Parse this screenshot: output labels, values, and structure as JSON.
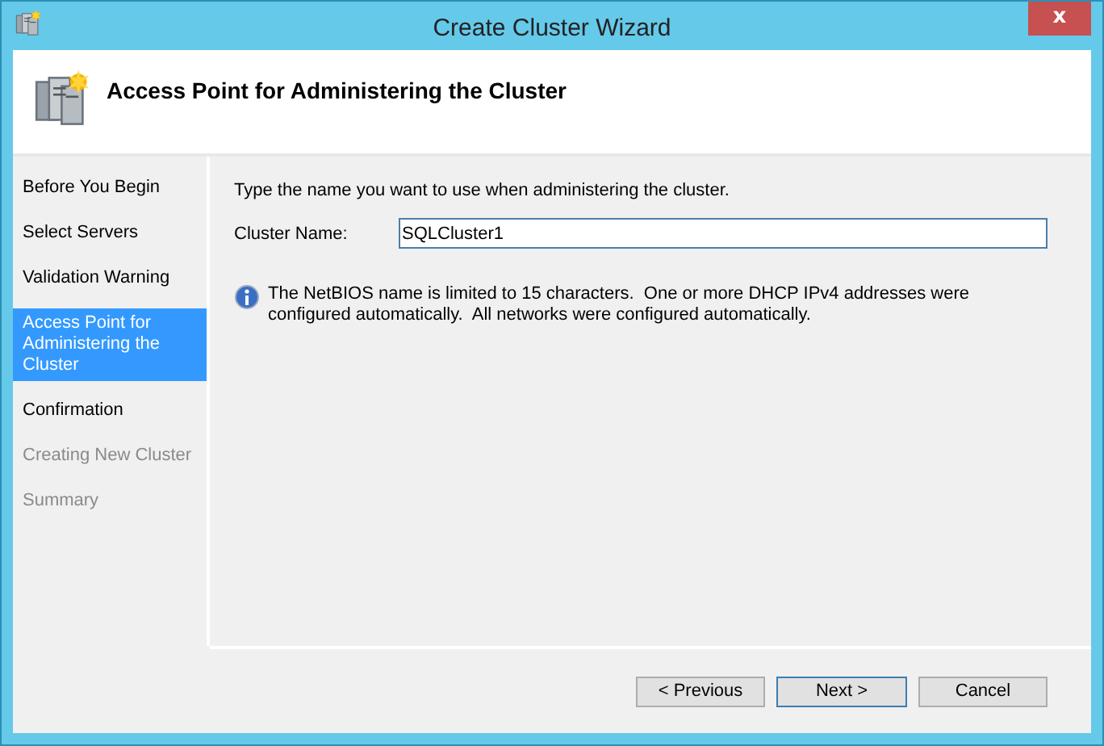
{
  "window": {
    "title": "Create Cluster Wizard",
    "close": "x"
  },
  "header": {
    "title": "Access Point for Administering the Cluster"
  },
  "steps": [
    {
      "label": "Before You Begin",
      "selected": false,
      "disabled": false
    },
    {
      "label": "Select Servers",
      "selected": false,
      "disabled": false
    },
    {
      "label": "Validation Warning",
      "selected": false,
      "disabled": false
    },
    {
      "label": "Access Point for Administering the Cluster",
      "selected": true,
      "disabled": false
    },
    {
      "label": "Confirmation",
      "selected": false,
      "disabled": false
    },
    {
      "label": "Creating New Cluster",
      "selected": false,
      "disabled": true
    },
    {
      "label": "Summary",
      "selected": false,
      "disabled": true
    }
  ],
  "instruction": "Type the name you want to use when administering the cluster.",
  "cluster_name": {
    "label": "Cluster Name:",
    "value": "SQLCluster1"
  },
  "info": "The NetBIOS name is limited to 15 characters.  One or more DHCP IPv4 addresses were configured automatically.  All networks were configured automatically.",
  "buttons": [
    {
      "label": "< Previous",
      "default": false
    },
    {
      "label": "Next >",
      "default": true
    },
    {
      "label": "Cancel",
      "default": false
    }
  ]
}
